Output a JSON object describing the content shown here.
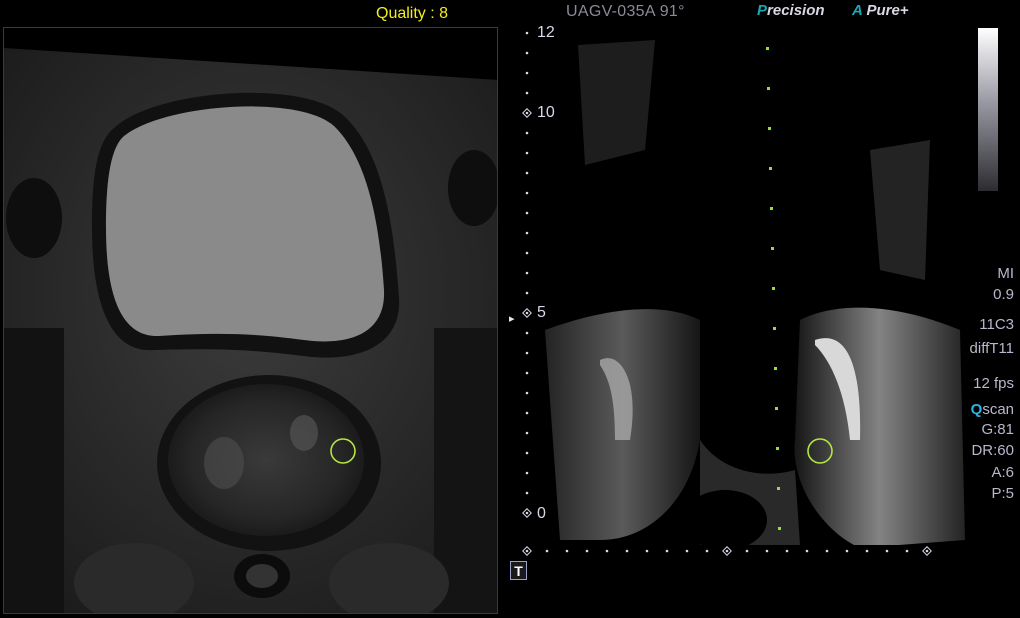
{
  "header": {
    "quality": "Quality : 8",
    "probe": "UAGV-035A 91°",
    "brand_precision_letter": "P",
    "brand_precision_rest": "recision",
    "brand_apure_letter": "A",
    "brand_apure_rest": "Pure+"
  },
  "depth_scale": {
    "labels": [
      "12",
      "10",
      "5",
      "0"
    ],
    "unit_marker": "▸"
  },
  "params": {
    "mi_label": "MI",
    "mi_value": "0.9",
    "probe_freq": "11C3",
    "mode": "diffT11",
    "fps": "12 fps",
    "qscan_q": "Q",
    "qscan_rest": "scan",
    "gain": "G:81",
    "dynamic_range": "DR:60",
    "a": "A:6",
    "p": "P:5"
  },
  "controls": {
    "t_button": "T"
  },
  "colors": {
    "quality": "#f2ee1c",
    "target_circle": "#b4e640",
    "needle_guide": "#9adc3c",
    "brand_teal": "#19a8b4",
    "panel_border": "#2c2ca8"
  }
}
